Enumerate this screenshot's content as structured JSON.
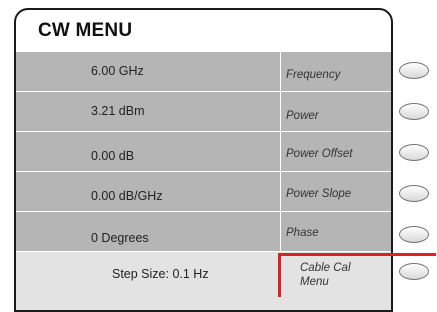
{
  "menu": {
    "title": "CW MENU",
    "rows": [
      {
        "value": "6.00 GHz",
        "label": "Frequency"
      },
      {
        "value": "3.21 dBm",
        "label": "Power"
      },
      {
        "value": "0.00 dB",
        "label": "Power Offset"
      },
      {
        "value": "0.00 dB/GHz",
        "label": "Power Slope"
      },
      {
        "value": "0 Degrees",
        "label": "Phase"
      },
      {
        "value": "Step Size: 0.1 Hz",
        "label": "Cable Cal Menu"
      }
    ]
  },
  "colors": {
    "row_background": "#b5b5b5",
    "last_row_background": "#e3e3e3",
    "highlight": "#e02020"
  }
}
